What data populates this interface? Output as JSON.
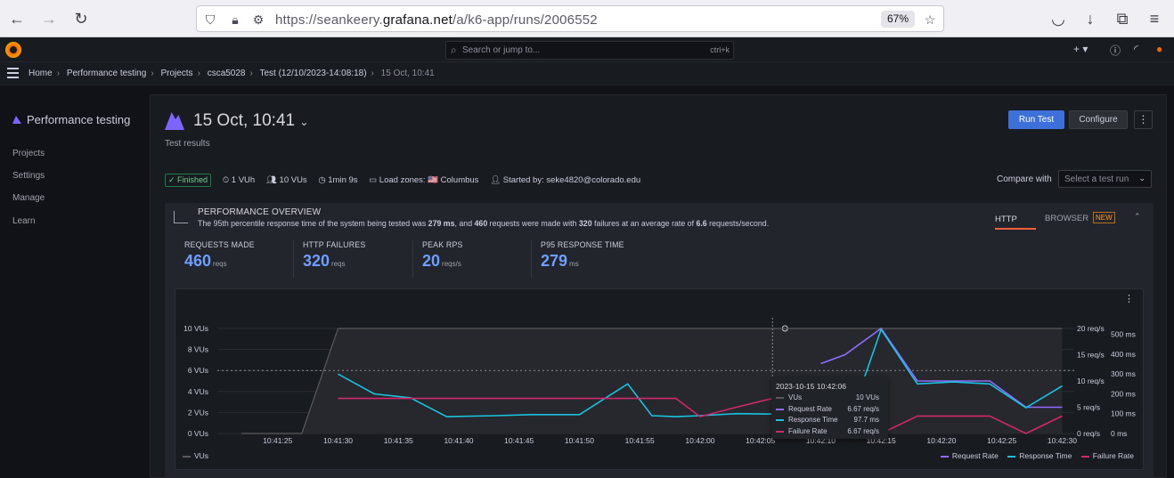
{
  "browser": {
    "url_prefix": "https://seankeery.",
    "url_domain": "grafana.net",
    "url_path": "/a/k6-app/runs/2006552",
    "zoom": "67%"
  },
  "topnav": {
    "search_placeholder": "Search or jump to...",
    "search_shortcut": "ctrl+k"
  },
  "breadcrumbs": [
    "Home",
    "Performance testing",
    "Projects",
    "csca5028",
    "Test (12/10/2023-14:08:18)",
    "15 Oct, 10:41"
  ],
  "sidebar": {
    "title": "Performance testing",
    "items": [
      "Projects",
      "Settings",
      "Manage",
      "Learn"
    ]
  },
  "header": {
    "title": "15 Oct, 10:41",
    "subtitle": "Test results",
    "run_button": "Run Test",
    "configure_button": "Configure"
  },
  "meta": {
    "status": "Finished",
    "vuh": "1 VUh",
    "vus": "10 VUs",
    "duration": "1min 9s",
    "load_zones": "Load zones: 🇺🇸 Columbus",
    "started_by": "Started by: seke4820@colorado.edu",
    "compare_label": "Compare with",
    "compare_placeholder": "Select a test run"
  },
  "overview": {
    "title": "PERFORMANCE OVERVIEW",
    "desc_1": "The 95th percentile response time of the system being tested was ",
    "desc_p95": "279 ms",
    "desc_2": ", and ",
    "desc_requests": "460",
    "desc_3": " requests were made with ",
    "desc_failures": "320",
    "desc_4": " failures at an average rate of ",
    "desc_rate": "6.6",
    "desc_5": " requests/second.",
    "tab_http": "HTTP",
    "tab_browser": "BROWSER",
    "new_badge": "NEW"
  },
  "stats": [
    {
      "label": "REQUESTS MADE",
      "value": "460",
      "unit": "reqs"
    },
    {
      "label": "HTTP FAILURES",
      "value": "320",
      "unit": "reqs"
    },
    {
      "label": "PEAK RPS",
      "value": "20",
      "unit": "reqs/s"
    },
    {
      "label": "P95 RESPONSE TIME",
      "value": "279",
      "unit": "ms"
    }
  ],
  "tooltip": {
    "time": "2023-10-15 10:42:06",
    "rows": [
      {
        "name": "VUs",
        "value": "10 VUs",
        "color": "#5a5a5a"
      },
      {
        "name": "Request Rate",
        "value": "6.67 req/s",
        "color": "#8f6eff"
      },
      {
        "name": "Response Time",
        "value": "97.7 ms",
        "color": "#19c3e0"
      },
      {
        "name": "Failure Rate",
        "value": "6.67 req/s",
        "color": "#d0286b"
      }
    ]
  },
  "chart_data": {
    "type": "line",
    "x": [
      "10:41:22",
      "10:41:24",
      "10:41:26",
      "10:41:30",
      "10:41:34",
      "10:41:37",
      "10:41:40",
      "10:41:44",
      "10:41:47",
      "10:41:50",
      "10:41:54",
      "10:41:56",
      "10:41:58",
      "10:42:00",
      "10:42:02",
      "10:42:06",
      "10:42:09",
      "10:42:12",
      "10:42:15",
      "10:42:18",
      "10:42:21",
      "10:42:24",
      "10:42:27",
      "10:42:30"
    ],
    "x_ticks": [
      "10:41:25",
      "10:41:30",
      "10:41:35",
      "10:41:40",
      "10:41:45",
      "10:41:50",
      "10:41:55",
      "10:42:00",
      "10:42:05",
      "10:42:10",
      "10:42:15",
      "10:42:20",
      "10:42:25",
      "10:42:30"
    ],
    "y_left_ticks": [
      "0 VUs",
      "2 VUs",
      "4 VUs",
      "6 VUs",
      "8 VUs",
      "10 VUs"
    ],
    "y_right1_ticks": [
      "0 req/s",
      "5 req/s",
      "10 req/s",
      "15 req/s",
      "20 req/s"
    ],
    "y_right2_ticks": [
      "0 ms",
      "100 ms",
      "200 ms",
      "300 ms",
      "400 ms",
      "500 ms"
    ],
    "series": [
      {
        "name": "VUs",
        "axis": "vus",
        "color": "#5a5a5a",
        "x": [
          "10:41:22",
          "10:41:25",
          "10:41:27",
          "10:41:30",
          "10:42:30"
        ],
        "values": [
          0,
          0,
          0,
          10,
          10
        ]
      },
      {
        "name": "Request Rate",
        "axis": "reqs",
        "color": "#8f6eff",
        "x": [
          "10:42:10",
          "10:42:12",
          "10:42:15",
          "10:42:18",
          "10:42:21",
          "10:42:24",
          "10:42:27",
          "10:42:30"
        ],
        "values": [
          13.3,
          15,
          20,
          10,
          10,
          10,
          5,
          5
        ]
      },
      {
        "name": "Response Time",
        "axis": "ms",
        "color": "#19c3e0",
        "x": [
          "10:41:30",
          "10:41:33",
          "10:41:36",
          "10:41:39",
          "10:41:43",
          "10:41:46",
          "10:41:50",
          "10:41:54",
          "10:41:56",
          "10:41:58",
          "10:42:00",
          "10:42:03",
          "10:42:06",
          "10:42:09",
          "10:42:12",
          "10:42:15",
          "10:42:18",
          "10:42:21",
          "10:42:24",
          "10:42:27",
          "10:42:30"
        ],
        "values": [
          300,
          200,
          180,
          85,
          90,
          95,
          95,
          250,
          90,
          85,
          90,
          100,
          97.7,
          85,
          0,
          525,
          250,
          260,
          250,
          130,
          240
        ]
      },
      {
        "name": "Failure Rate",
        "axis": "reqs",
        "color": "#d0286b",
        "x": [
          "10:41:30",
          "10:41:55",
          "10:41:58",
          "10:42:00",
          "10:42:03",
          "10:42:06",
          "10:42:10",
          "10:42:12",
          "10:42:15",
          "10:42:18",
          "10:42:21",
          "10:42:24",
          "10:42:27",
          "10:42:30"
        ],
        "values": [
          6.67,
          6.67,
          6.67,
          3.2,
          5,
          6.67,
          6.67,
          0,
          0,
          3.33,
          3.33,
          3.33,
          0,
          3.33
        ]
      }
    ],
    "threshold_vus": 6,
    "hover_time": "10:42:06",
    "legend_position": "bottom"
  }
}
